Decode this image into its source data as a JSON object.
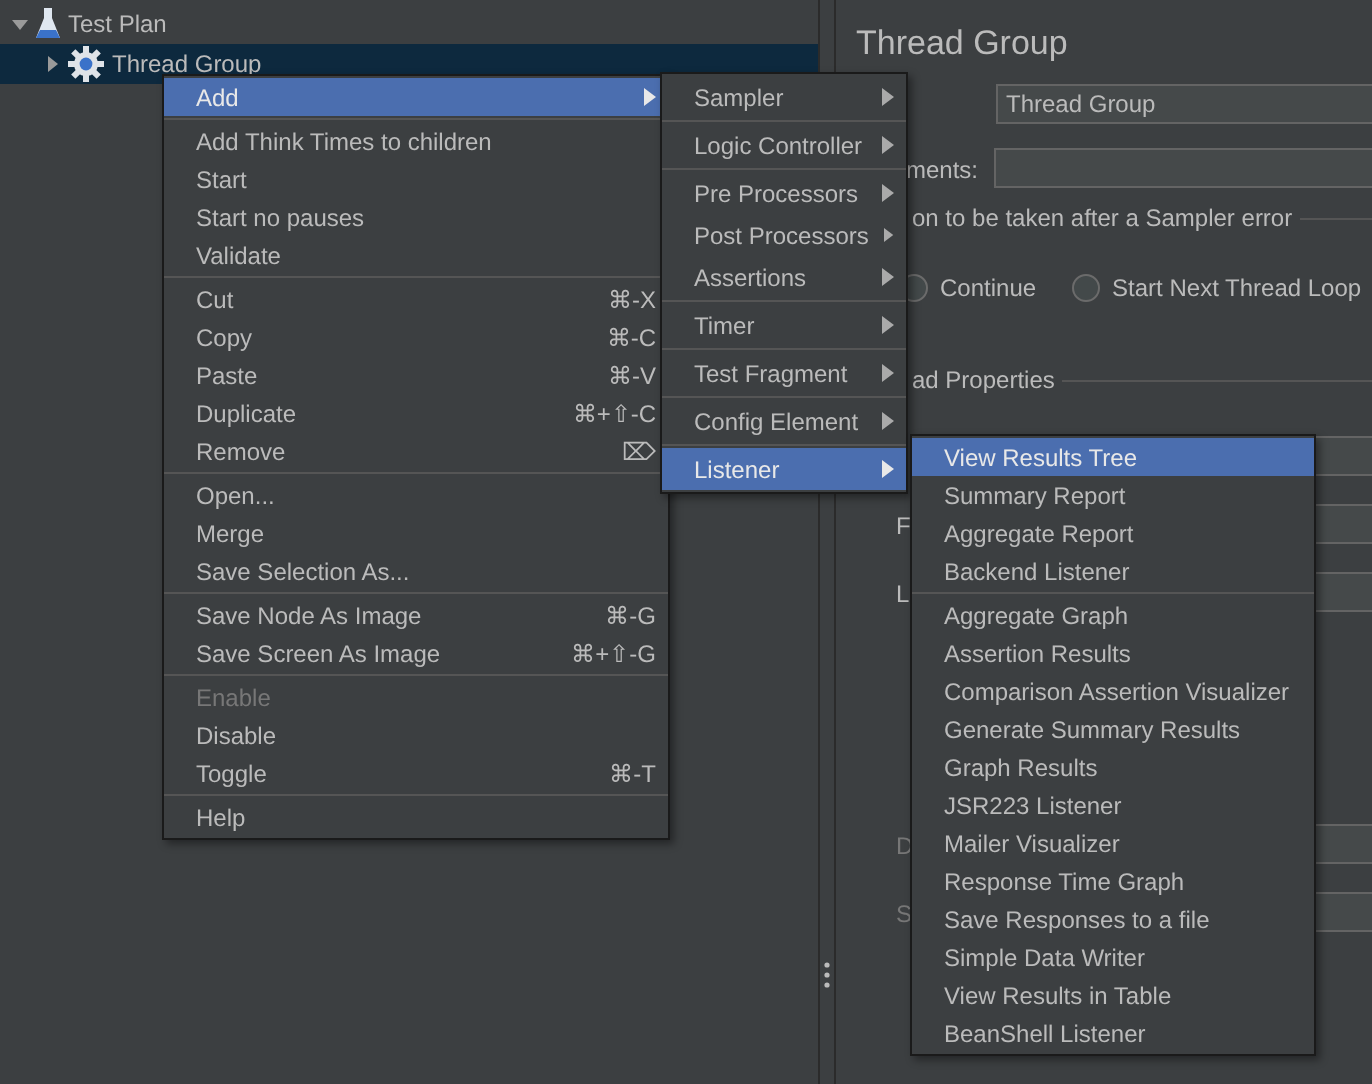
{
  "tree": [
    {
      "label": "Test Plan",
      "kind": "plan",
      "expanded": true,
      "selected": false,
      "children": [
        {
          "label": "Thread Group",
          "kind": "thread_group",
          "expanded": false,
          "selected": true
        }
      ]
    }
  ],
  "editor": {
    "title": "Thread Group",
    "name_value": "Thread Group",
    "comments_label": "ments:",
    "error_group": "on to be taken after a Sampler error",
    "radios": [
      {
        "label": "Continue",
        "selected": false
      },
      {
        "label": "Start Next Thread Loop",
        "selected": false
      }
    ],
    "properties_group": "ad Properties",
    "rows": [
      {
        "label": "F",
        "disabled": false
      },
      {
        "label": "L",
        "disabled": false
      },
      {
        "label": "D",
        "disabled": true
      },
      {
        "label": "S",
        "disabled": true
      }
    ]
  },
  "context_menu": {
    "groups": [
      [
        {
          "label": "Add",
          "submenu": true,
          "selected": true,
          "disabled": false
        }
      ],
      [
        {
          "label": "Add Think Times to children",
          "submenu": false,
          "selected": false,
          "disabled": false
        },
        {
          "label": "Start",
          "submenu": false,
          "selected": false,
          "disabled": false
        },
        {
          "label": "Start no pauses",
          "submenu": false,
          "selected": false,
          "disabled": false
        },
        {
          "label": "Validate",
          "submenu": false,
          "selected": false,
          "disabled": false
        }
      ],
      [
        {
          "label": "Cut",
          "shortcut": "⌘-X",
          "submenu": false,
          "selected": false,
          "disabled": false
        },
        {
          "label": "Copy",
          "shortcut": "⌘-C",
          "submenu": false,
          "selected": false,
          "disabled": false
        },
        {
          "label": "Paste",
          "shortcut": "⌘-V",
          "submenu": false,
          "selected": false,
          "disabled": false
        },
        {
          "label": "Duplicate",
          "shortcut": "⌘+⇧-C",
          "submenu": false,
          "selected": false,
          "disabled": false
        },
        {
          "label": "Remove",
          "shortcut": "⌦",
          "submenu": false,
          "selected": false,
          "disabled": false
        }
      ],
      [
        {
          "label": "Open...",
          "submenu": false,
          "selected": false,
          "disabled": false
        },
        {
          "label": "Merge",
          "submenu": false,
          "selected": false,
          "disabled": false
        },
        {
          "label": "Save Selection As...",
          "submenu": false,
          "selected": false,
          "disabled": false
        }
      ],
      [
        {
          "label": "Save Node As Image",
          "shortcut": "⌘-G",
          "submenu": false,
          "selected": false,
          "disabled": false
        },
        {
          "label": "Save Screen As Image",
          "shortcut": "⌘+⇧-G",
          "submenu": false,
          "selected": false,
          "disabled": false
        }
      ],
      [
        {
          "label": "Enable",
          "submenu": false,
          "selected": false,
          "disabled": true
        },
        {
          "label": "Disable",
          "submenu": false,
          "selected": false,
          "disabled": false
        },
        {
          "label": "Toggle",
          "shortcut": "⌘-T",
          "submenu": false,
          "selected": false,
          "disabled": false
        }
      ],
      [
        {
          "label": "Help",
          "submenu": false,
          "selected": false,
          "disabled": false
        }
      ]
    ]
  },
  "add_menu": {
    "groups": [
      [
        {
          "label": "Sampler",
          "submenu": true,
          "selected": false,
          "disabled": false
        }
      ],
      [
        {
          "label": "Logic Controller",
          "submenu": true,
          "selected": false,
          "disabled": false
        }
      ],
      [
        {
          "label": "Pre Processors",
          "submenu": true,
          "selected": false,
          "disabled": false
        },
        {
          "label": "Post Processors",
          "submenu": true,
          "selected": false,
          "disabled": false
        },
        {
          "label": "Assertions",
          "submenu": true,
          "selected": false,
          "disabled": false
        }
      ],
      [
        {
          "label": "Timer",
          "submenu": true,
          "selected": false,
          "disabled": false
        }
      ],
      [
        {
          "label": "Test Fragment",
          "submenu": true,
          "selected": false,
          "disabled": false
        }
      ],
      [
        {
          "label": "Config Element",
          "submenu": true,
          "selected": false,
          "disabled": false
        }
      ],
      [
        {
          "label": "Listener",
          "submenu": true,
          "selected": true,
          "disabled": false
        }
      ]
    ]
  },
  "listener_menu": {
    "groups": [
      [
        {
          "label": "View Results Tree",
          "submenu": false,
          "selected": true,
          "disabled": false
        },
        {
          "label": "Summary Report",
          "submenu": false,
          "selected": false,
          "disabled": false
        },
        {
          "label": "Aggregate Report",
          "submenu": false,
          "selected": false,
          "disabled": false
        },
        {
          "label": "Backend Listener",
          "submenu": false,
          "selected": false,
          "disabled": false
        }
      ],
      [
        {
          "label": "Aggregate Graph",
          "submenu": false,
          "selected": false,
          "disabled": false
        },
        {
          "label": "Assertion Results",
          "submenu": false,
          "selected": false,
          "disabled": false
        },
        {
          "label": "Comparison Assertion Visualizer",
          "submenu": false,
          "selected": false,
          "disabled": false
        },
        {
          "label": "Generate Summary Results",
          "submenu": false,
          "selected": false,
          "disabled": false
        },
        {
          "label": "Graph Results",
          "submenu": false,
          "selected": false,
          "disabled": false
        },
        {
          "label": "JSR223 Listener",
          "submenu": false,
          "selected": false,
          "disabled": false
        },
        {
          "label": "Mailer Visualizer",
          "submenu": false,
          "selected": false,
          "disabled": false
        },
        {
          "label": "Response Time Graph",
          "submenu": false,
          "selected": false,
          "disabled": false
        },
        {
          "label": "Save Responses to a file",
          "submenu": false,
          "selected": false,
          "disabled": false
        },
        {
          "label": "Simple Data Writer",
          "submenu": false,
          "selected": false,
          "disabled": false
        },
        {
          "label": "View Results in Table",
          "submenu": false,
          "selected": false,
          "disabled": false
        },
        {
          "label": "BeanShell Listener",
          "submenu": false,
          "selected": false,
          "disabled": false
        }
      ]
    ]
  }
}
